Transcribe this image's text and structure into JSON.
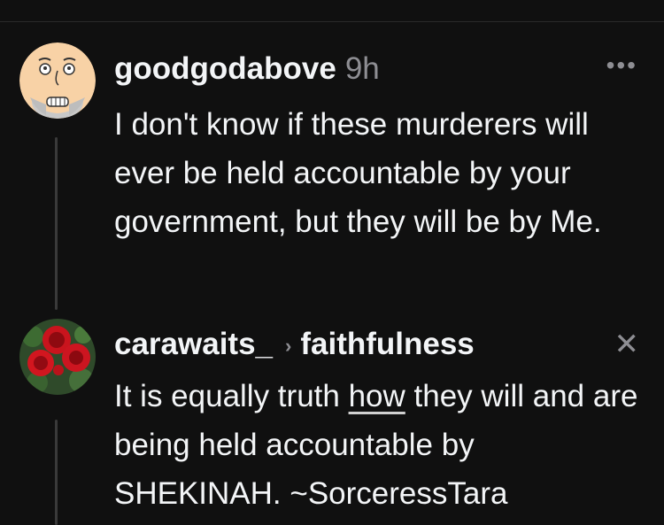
{
  "post1": {
    "username": "goodgodabove",
    "time": "9h",
    "more_icon": "ellipsis-icon",
    "text": "I don't know if these murderers will ever be held accountable by your government, but they will be by Me."
  },
  "post2": {
    "username": "carawaits_",
    "reply_arrow": "›",
    "reply_to": "faithfulness",
    "close_icon": "close-icon",
    "text_before": "It is equally truth ",
    "text_link": "how",
    "text_after": " they will and are being held accountable by SHEKINAH. ~SorceressTara"
  }
}
